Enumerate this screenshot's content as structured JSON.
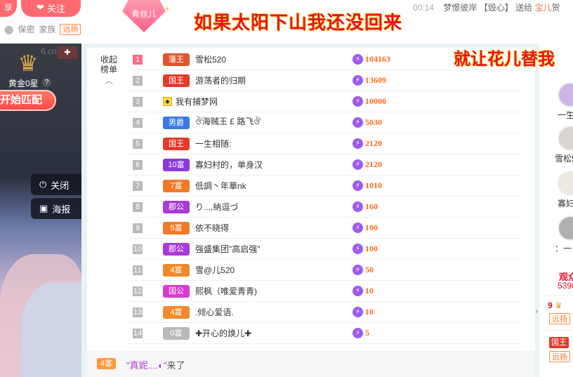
{
  "header": {
    "share_label": "享",
    "follow_label": "关注",
    "meta_protect": "保密",
    "meta_family": "家族",
    "fans_tag": "远扬",
    "youth_badge": "青丝儿",
    "banner": "如果太阳下山我还没回来",
    "ticker": {
      "time": "00:14",
      "from": "梦憬彼岸",
      "gift": "【毁心】",
      "action": "送给",
      "to": "宝儿",
      "tail": "贺"
    }
  },
  "video": {
    "site_mark": "6.cn",
    "rank": "黄金0星",
    "help": "?",
    "match_button": "开始匹配",
    "close_button": "关闭",
    "poster_button": "海报"
  },
  "ranking": {
    "collapse_label": "收起",
    "collapse_label2": "榜单",
    "rows": [
      {
        "rank": "1",
        "badge": "藩王",
        "badge_color": "#e0562a",
        "name": "雪松520",
        "amount": "104163"
      },
      {
        "rank": "2",
        "badge": "国王",
        "badge_color": "#e43a2c",
        "name": "游荡者的归期",
        "amount": "13609"
      },
      {
        "rank": "3",
        "badge": "",
        "badge_color": "",
        "name": "我有捕梦网",
        "amount": "10000"
      },
      {
        "rank": "4",
        "badge": "男爵",
        "badge_color": "#3a7ae8",
        "name": "ঔ海贼王 £ 路飞ঔ",
        "amount": "5030"
      },
      {
        "rank": "5",
        "badge": "国王",
        "badge_color": "#e43a2c",
        "name": "一生相随:",
        "amount": "2120"
      },
      {
        "rank": "6",
        "badge": "10富",
        "badge_color": "#8a3ad8",
        "name": "寡妇村的，单身汉",
        "amount": "2120"
      },
      {
        "rank": "7",
        "badge": "7富",
        "badge_color": "#f07a2a",
        "name": "低調丶年華nk",
        "amount": "1010"
      },
      {
        "rank": "8",
        "badge": "郡公",
        "badge_color": "#a83ad8",
        "name": "り..,,納逗づ",
        "amount": "160"
      },
      {
        "rank": "9",
        "badge": "5富",
        "badge_color": "#f07a2a",
        "name": "依不晓得",
        "amount": "100"
      },
      {
        "rank": "10",
        "badge": "郡公",
        "badge_color": "#a83ad8",
        "name": "强盛集团\"高启强\"",
        "amount": "100"
      },
      {
        "rank": "11",
        "badge": "4富",
        "badge_color": "#f08a2a",
        "name": "雪@儿520",
        "amount": "50"
      },
      {
        "rank": "12",
        "badge": "国公",
        "badge_color": "#d83ad0",
        "name": "熙枫（唯爱青青)",
        "amount": "10"
      },
      {
        "rank": "13",
        "badge": "4富",
        "badge_color": "#f08a2a",
        "name": ".倾心爱语.",
        "amount": "10"
      },
      {
        "rank": "14",
        "badge": "0富",
        "badge_color": "#b8b8b8",
        "name": "✚开心的焕儿✚",
        "amount": "5"
      }
    ]
  },
  "footer": {
    "badge": "4富",
    "user": "\"真妮....◐\"",
    "suffix": "来了"
  },
  "right": {
    "banner": "就让花儿替我",
    "names": [
      "一生",
      "雪松5",
      "寡妇",
      "：一"
    ],
    "viewer_title": "观众",
    "viewer_count": "5390",
    "viewer_rank": "9",
    "viewer_tag": "远扬",
    "viewer_badge": "国王",
    "viewer_tag2": "远扬"
  },
  "colors": {
    "accent": "#ff6a70",
    "banner_red": "#e8102a",
    "amount_orange": "#ff6a1a",
    "coin_purple": "#9b5bf0"
  }
}
